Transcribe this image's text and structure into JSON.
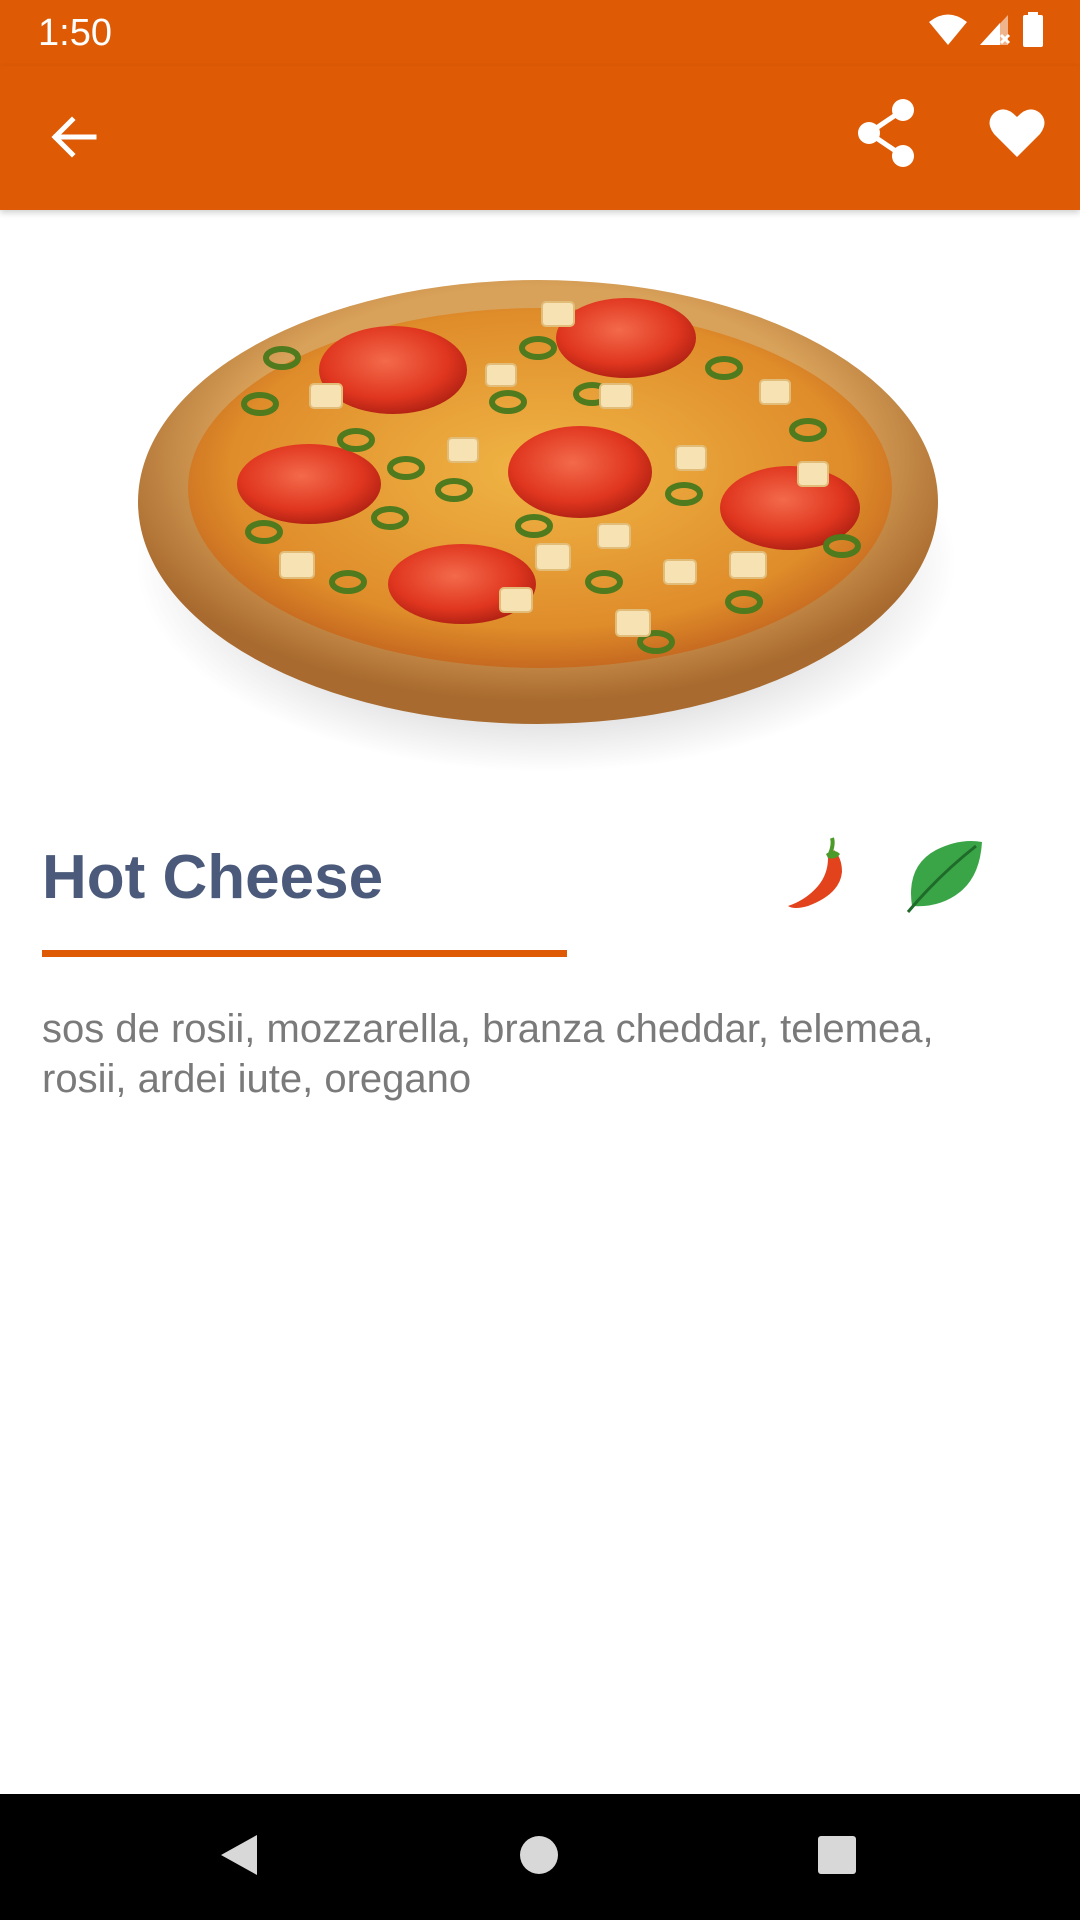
{
  "status_bar": {
    "time": "1:50",
    "icons": [
      "wifi-icon",
      "cellular-no-signal-icon",
      "battery-icon"
    ]
  },
  "app_bar": {
    "background_color": "#de5a04",
    "icons": [
      "back-arrow-icon",
      "share-icon",
      "heart-icon"
    ]
  },
  "product": {
    "image": "pizza-image",
    "title": "Hot Cheese",
    "badges": [
      "chili-pepper-icon",
      "leaf-icon"
    ],
    "ingredients": "sos de rosii, mozzarella, branza cheddar, telemea, rosii, ardei iute, oregano",
    "title_color": "#4b5a7a",
    "accent_color": "#de5a04"
  },
  "nav_bar": {
    "icons": [
      "nav-back-icon",
      "nav-home-icon",
      "nav-recents-icon"
    ]
  }
}
